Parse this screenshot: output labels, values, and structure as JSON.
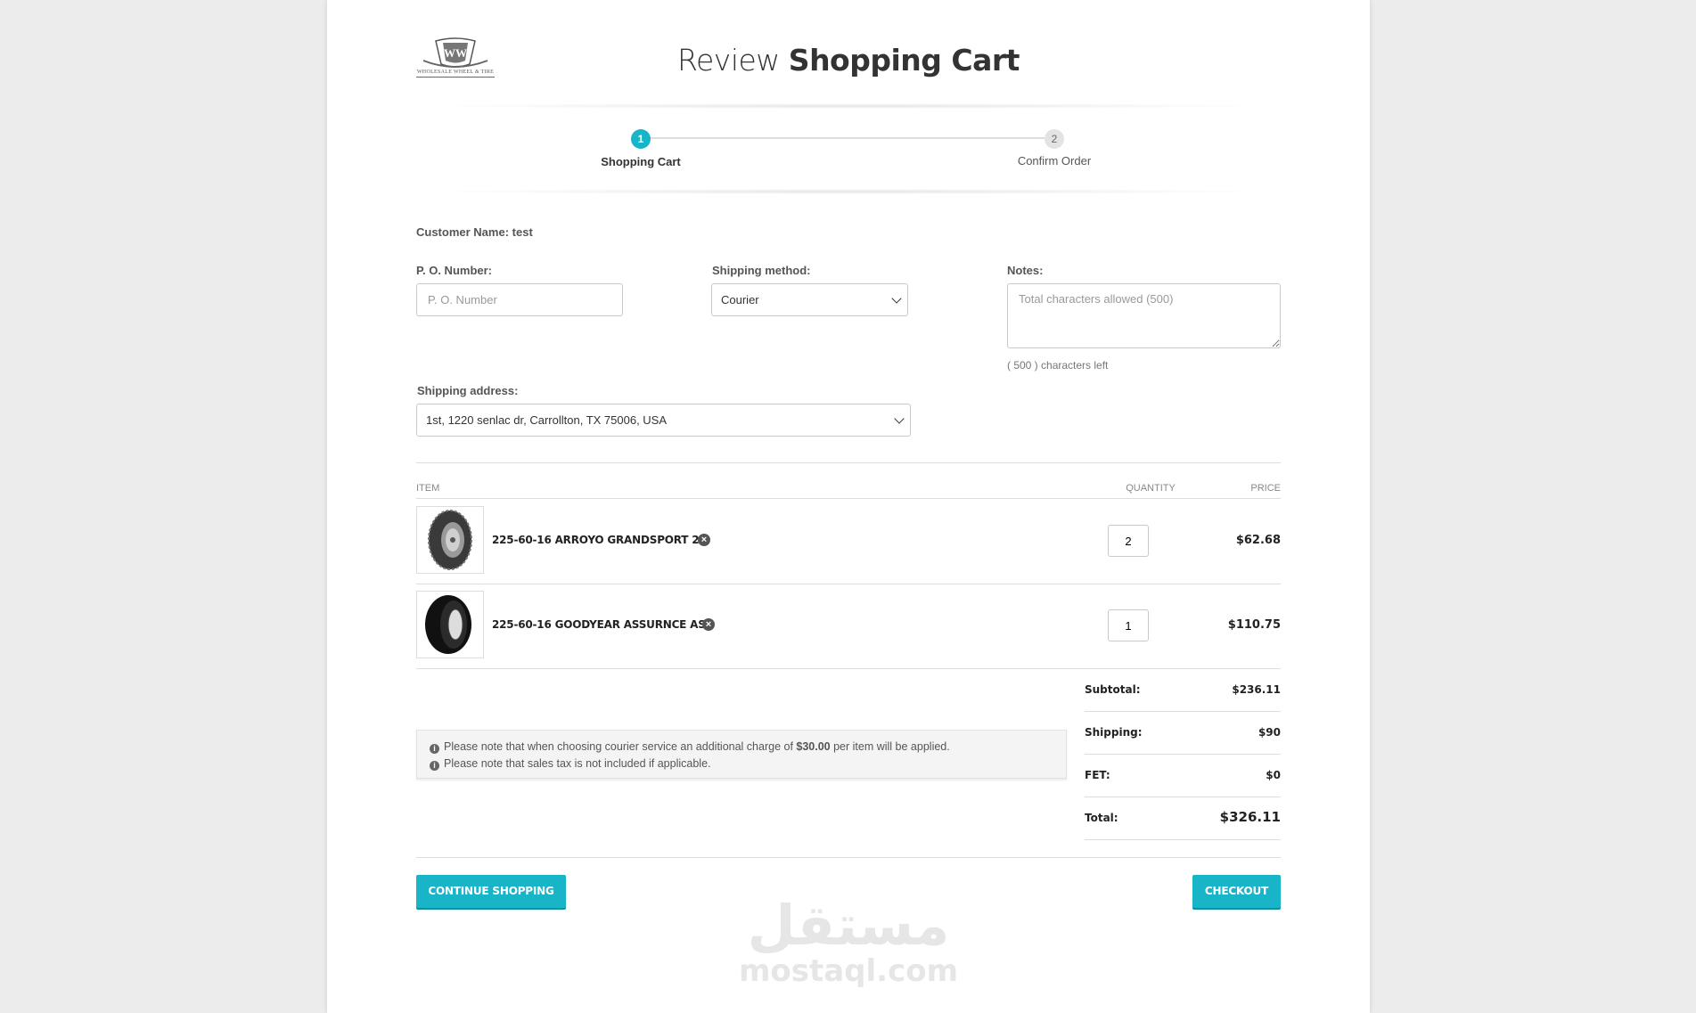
{
  "brand": {
    "logo_text": "WHOLESALE WHEEL & TIRE",
    "logo_icon": "shield-crest-icon"
  },
  "header": {
    "title_prefix": "Review",
    "title_main": "Shopping Cart"
  },
  "steps": [
    {
      "number": "1",
      "label": "Shopping Cart",
      "active": true
    },
    {
      "number": "2",
      "label": "Confirm Order",
      "active": false
    }
  ],
  "customer": {
    "label": "Customer Name:",
    "name": "test"
  },
  "form": {
    "po_label": "P. O. Number:",
    "po_placeholder": "P. O. Number",
    "po_value": "",
    "shipping_method_label": "Shipping method:",
    "shipping_method_value": "Courier",
    "notes_label": "Notes:",
    "notes_placeholder": "Total characters allowed (500)",
    "chars_left": "( 500 ) characters left",
    "shipping_address_label": "Shipping address:",
    "shipping_address_value": "1st, 1220 senlac dr, Carrollton, TX 75006, USA"
  },
  "table": {
    "headers": {
      "item": "ITEM",
      "quantity": "QUANTITY",
      "price": "PRICE"
    },
    "rows": [
      {
        "name": "225-60-16 ARROYO GRANDSPORT 2",
        "quantity": "2",
        "price": "$62.68",
        "image_icon": "tire-icon"
      },
      {
        "name": "225-60-16 GOODYEAR ASSURNCE AS",
        "quantity": "1",
        "price": "$110.75",
        "image_icon": "tire-icon"
      }
    ]
  },
  "notes": {
    "line1_pre": "Please note that when choosing courier service an additional charge of ",
    "line1_amount": "$30.00",
    "line1_post": " per item will be applied.",
    "line2": "Please note that sales tax is not included if applicable."
  },
  "totals": {
    "subtotal_label": "Subtotal:",
    "subtotal": "$236.11",
    "shipping_label": "Shipping:",
    "shipping": "$90",
    "fet_label": "FET:",
    "fet": "$0",
    "total_label": "Total:",
    "total": "$326.11"
  },
  "buttons": {
    "continue": "CONTINUE SHOPPING",
    "checkout": "CHECKOUT"
  },
  "watermark": {
    "arabic": "مستقل",
    "latin": "mostaql.com"
  },
  "colors": {
    "accent": "#17b5c7",
    "step_inactive": "#e3e3e3",
    "background": "#ececec"
  }
}
